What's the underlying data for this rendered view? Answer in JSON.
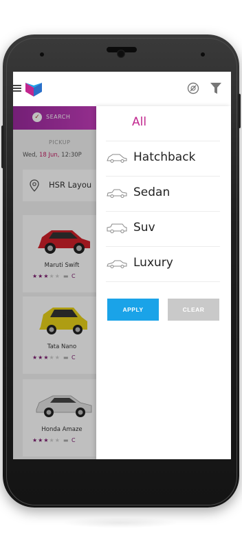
{
  "app": {
    "colors": {
      "accent": "#c1268e",
      "apply": "#1aa3e8",
      "clear": "#c9c9c9",
      "search_gradient": [
        "#9b2a9e",
        "#c83fbf"
      ]
    }
  },
  "header": {
    "icons": {
      "menu": "menu-icon",
      "logo": "logo-icon",
      "settings": "settings-icon",
      "filter": "filter-icon"
    }
  },
  "background": {
    "search_label": "SEARCH",
    "pickup_label": "PICKUP",
    "pickup_date_prefix": "Wed, ",
    "pickup_date_accent": "18 Jun,",
    "pickup_date_suffix": " 12:30P",
    "location_text": "HSR Layou",
    "cars": [
      {
        "name": "Maruti Swift",
        "rating": 3,
        "max_rating": 5,
        "seat_text": "C",
        "color": "#d0202a"
      },
      {
        "name": "Tata Nano",
        "rating": 3,
        "max_rating": 5,
        "seat_text": "C",
        "color": "#e8d21a"
      },
      {
        "name": "Honda Amaze",
        "rating": 3,
        "max_rating": 5,
        "seat_text": "C",
        "color": "#e2e2e2"
      }
    ]
  },
  "filter_panel": {
    "options": [
      {
        "label": "All",
        "icon": "",
        "selected": true
      },
      {
        "label": "Hatchback",
        "icon": "hatchback-icon",
        "selected": false
      },
      {
        "label": "Sedan",
        "icon": "sedan-icon",
        "selected": false
      },
      {
        "label": "Suv",
        "icon": "suv-icon",
        "selected": false
      },
      {
        "label": "Luxury",
        "icon": "luxury-icon",
        "selected": false
      }
    ],
    "apply_label": "APPLY",
    "clear_label": "CLEAR"
  }
}
